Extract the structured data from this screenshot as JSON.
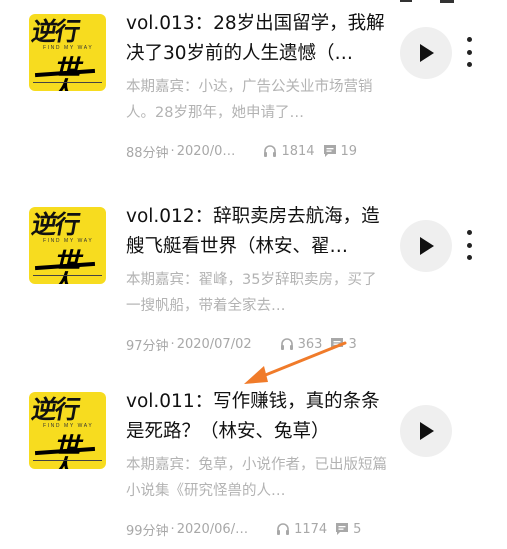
{
  "episodes": [
    {
      "cover": {
        "title": "逆行",
        "subtitle": "FIND MY WAY",
        "logo": "世人"
      },
      "title": "vol.013：28岁出国留学，我解决了30岁前的人生遗憾（…",
      "description": "本期嘉宾：小达，广告公关业市场营销人。28岁那年，她申请了…",
      "duration": "88分钟",
      "date": "2020/0…",
      "listens": "1814",
      "comments": "19"
    },
    {
      "cover": {
        "title": "逆行",
        "subtitle": "FIND MY WAY",
        "logo": "世人"
      },
      "title": "vol.012：辞职卖房去航海，造艘飞艇看世界（林安、翟…",
      "description": "本期嘉宾：翟峰，35岁辞职卖房，买了一搜帆船，带着全家去…",
      "duration": "97分钟",
      "date": "2020/07/02",
      "listens": "363",
      "comments": "3"
    },
    {
      "cover": {
        "title": "逆行",
        "subtitle": "FIND MY WAY",
        "logo": "世人"
      },
      "title": "vol.011：写作赚钱，真的条条是死路？（林安、兔草）",
      "description": "本期嘉宾：兔草，小说作者，已出版短篇小说集《研究怪兽的人…",
      "duration": "99分钟",
      "date": "2020/06/…",
      "listens": "1174",
      "comments": "5"
    }
  ],
  "separator": "·",
  "icons": {
    "play": "play-icon",
    "more": "more-vertical-icon",
    "listens": "headphones-icon",
    "comments": "comment-icon"
  },
  "colors": {
    "cover_bg": "#f7dc1f",
    "title": "#111111",
    "meta": "#a8a8a8",
    "annotation_arrow": "#f07b2a"
  }
}
